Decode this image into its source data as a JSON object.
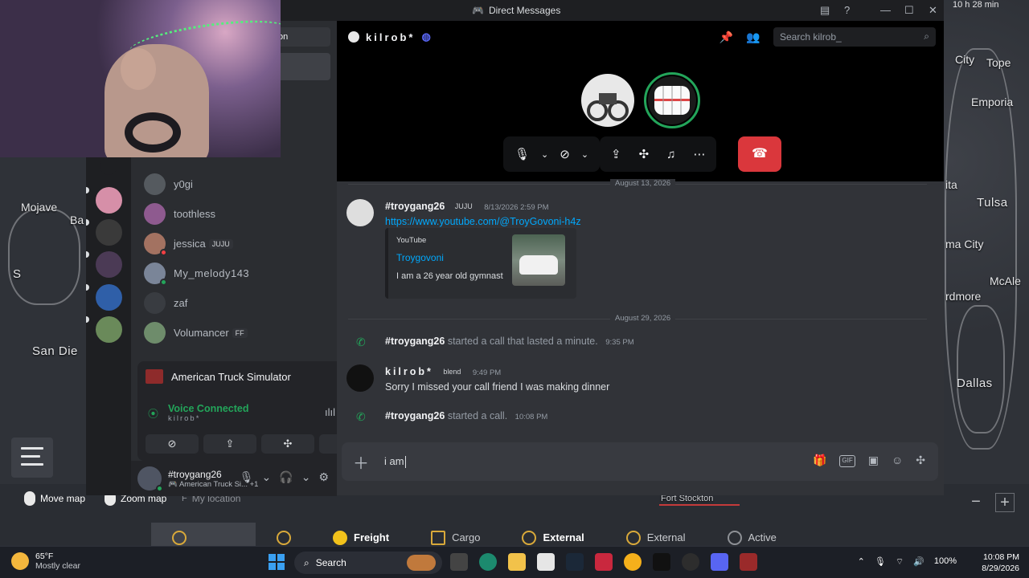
{
  "overlay": {
    "timer": "10 h 28 min"
  },
  "map": {
    "cities": [
      {
        "name": "Mojave"
      },
      {
        "name": "Ba"
      },
      {
        "name": "S"
      },
      {
        "name": "San Die"
      },
      {
        "name": "City"
      },
      {
        "name": "Tope"
      },
      {
        "name": "Emporia"
      },
      {
        "name": "ita"
      },
      {
        "name": "Tulsa"
      },
      {
        "name": "ma City"
      },
      {
        "name": "McAle"
      },
      {
        "name": "rdmore"
      },
      {
        "name": "Dallas"
      },
      {
        "name": "Fort Stockton"
      }
    ],
    "controls": {
      "move": "Move map",
      "zoom": "Zoom map",
      "location": "My location"
    },
    "bottom_tabs": [
      "Freight",
      "Cargo",
      "External",
      "External",
      "Active"
    ]
  },
  "discord": {
    "window_title": "Direct Messages",
    "sidebar_partial_label": "on",
    "dms": [
      {
        "name": "y0gi",
        "badge": ""
      },
      {
        "name": "toothless",
        "badge": ""
      },
      {
        "name": "jessica",
        "badge": "JUJU"
      },
      {
        "name": "My_melody143",
        "badge": ""
      },
      {
        "name": "zaf",
        "badge": ""
      },
      {
        "name": "Volumancer",
        "badge": "FF"
      }
    ],
    "activity": {
      "game": "American Truck Simulator",
      "voice_status": "Voice Connected",
      "voice_channel": "kilrob*"
    },
    "user": {
      "name": "#troygang26",
      "status": "American Truck Si...",
      "extra": "+1"
    },
    "channel": {
      "name": "kilrob*",
      "search_placeholder": "Search kilrob_"
    },
    "messages": {
      "divider1": "August 13, 2026",
      "m1_author": "#troygang26",
      "m1_badge": "JUJU",
      "m1_time": "8/13/2026 2:59 PM",
      "m1_link": "https://www.youtube.com/@TroyGovoni-h4z",
      "embed_provider": "YouTube",
      "embed_title": "Troygovoni",
      "embed_desc": "I am a 26 year old gymnast",
      "divider2": "August 29, 2026",
      "call1_author": "#troygang26",
      "call1_text": "started a call that lasted a minute.",
      "call1_time": "9:35 PM",
      "m2_author": "kilrob*",
      "m2_badge": "blend",
      "m2_time": "9:49 PM",
      "m2_text": "Sorry I missed your call friend I was making dinner",
      "call2_author": "#troygang26",
      "call2_text": "started a call.",
      "call2_time": "10:08 PM"
    },
    "composer": {
      "value": "i am"
    }
  },
  "taskbar": {
    "temp": "65°F",
    "weather": "Mostly clear",
    "search": "Search",
    "battery": "100%",
    "time": "10:08 PM",
    "date": "8/29/2026"
  },
  "colors": {
    "accent_green": "#23a55a",
    "hangup_red": "#da373c",
    "link_blue": "#00a8fc"
  }
}
